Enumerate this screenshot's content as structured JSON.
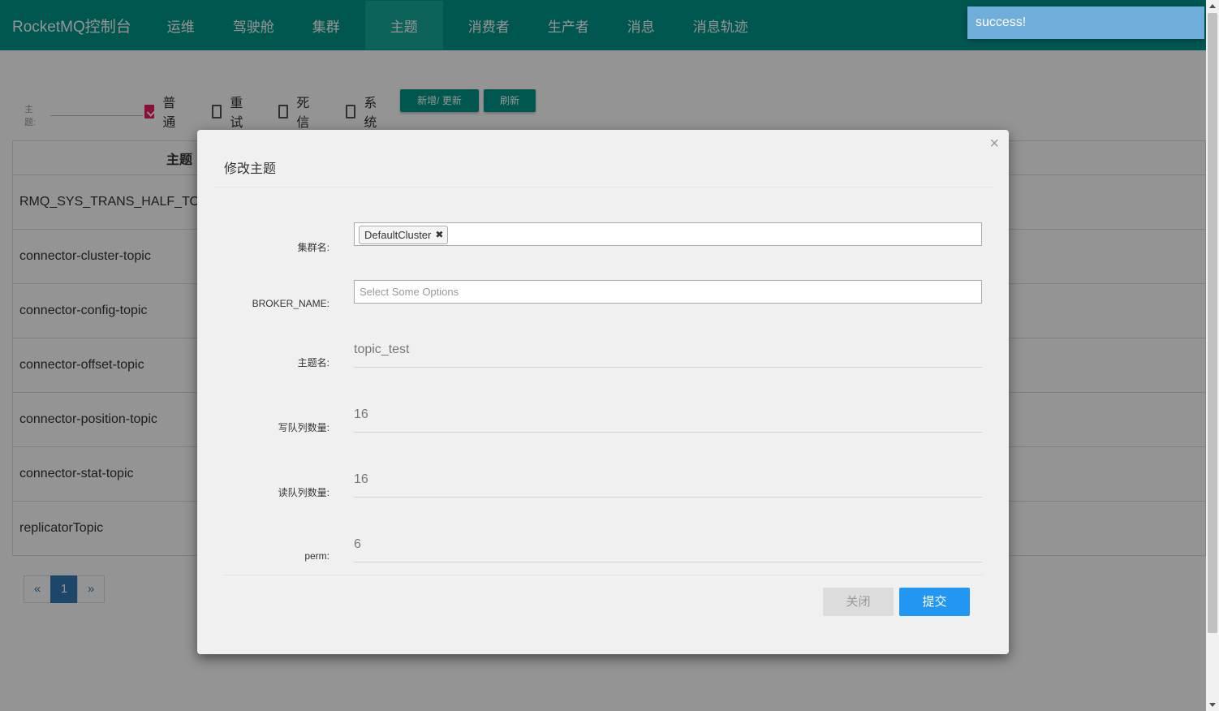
{
  "navbar": {
    "brand": "RocketMQ控制台",
    "items": [
      "运维",
      "驾驶舱",
      "集群",
      "主题",
      "消费者",
      "生产者",
      "消息",
      "消息轨迹"
    ],
    "active": "主题"
  },
  "toast": {
    "message": "success!"
  },
  "filter": {
    "label": "主题:",
    "input_value": "",
    "checkboxes": [
      {
        "label": "普通",
        "checked": true
      },
      {
        "label": "重试",
        "checked": false
      },
      {
        "label": "死信",
        "checked": false
      },
      {
        "label": "系统",
        "checked": false
      }
    ],
    "add_update_label": "新增/ 更新",
    "refresh_label": "刷新"
  },
  "table": {
    "header": "主题",
    "rows": [
      "RMQ_SYS_TRANS_HALF_TO",
      "connector-cluster-topic",
      "connector-config-topic",
      "connector-offset-topic",
      "connector-position-topic",
      "connector-stat-topic",
      "replicatorTopic"
    ]
  },
  "pagination": {
    "prev": "«",
    "current": "1",
    "next": "»"
  },
  "modal": {
    "title": "修改主题",
    "close_icon": "×",
    "fields": {
      "cluster_label": "集群名:",
      "cluster_chip": "DefaultCluster",
      "chip_remove": "✖",
      "broker_label": "BROKER_NAME:",
      "broker_placeholder": "Select Some Options",
      "topic_label": "主题名:",
      "topic_value": "topic_test",
      "write_label": "写队列数量:",
      "write_value": "16",
      "read_label": "读队列数量:",
      "read_value": "16",
      "perm_label": "perm:",
      "perm_value": "6"
    },
    "close_button": "关闭",
    "submit_button": "提交"
  },
  "colors": {
    "primary": "#009688",
    "accent": "#e91e63",
    "submit": "#2196f3"
  }
}
